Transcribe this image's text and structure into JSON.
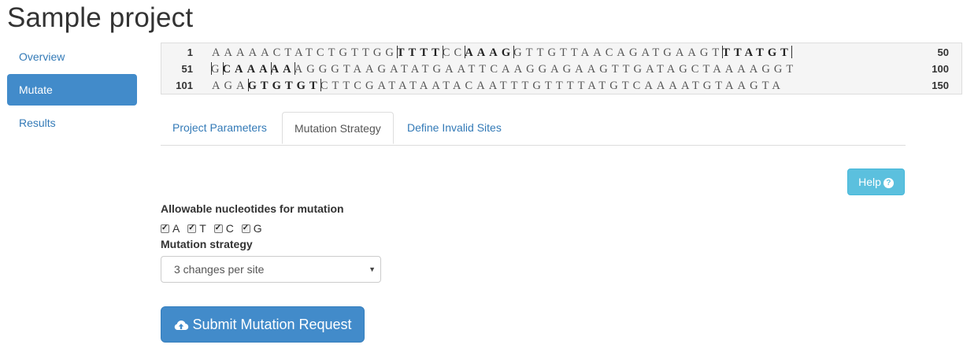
{
  "page": {
    "title": "Sample project"
  },
  "sidebar": {
    "items": [
      {
        "label": "Overview",
        "active": false
      },
      {
        "label": "Mutate",
        "active": true
      },
      {
        "label": "Results",
        "active": false
      }
    ]
  },
  "sequence": {
    "rows": [
      {
        "start": "1",
        "end": "50",
        "parts": [
          {
            "t": "AAAAACTATCTGTTGG",
            "b": false
          },
          {
            "t": "|",
            "bar": true
          },
          {
            "t": "TTTT",
            "b": true
          },
          {
            "t": "|",
            "bar": true
          },
          {
            "t": "CC",
            "b": false
          },
          {
            "t": "|",
            "bar": true
          },
          {
            "t": "AAAG",
            "b": true
          },
          {
            "t": "|",
            "bar": true
          },
          {
            "t": "GTTGTTAACAGATGAAGT",
            "b": false
          },
          {
            "t": "|",
            "bar": true
          },
          {
            "t": "TTATGT",
            "b": true
          },
          {
            "t": "|",
            "bar": true
          }
        ]
      },
      {
        "start": "51",
        "end": "100",
        "parts": [
          {
            "t": "|",
            "bar": true
          },
          {
            "t": "G",
            "b": false
          },
          {
            "t": "|",
            "bar": true
          },
          {
            "t": "CAAA",
            "b": true
          },
          {
            "t": "|",
            "bar": true
          },
          {
            "t": "AA",
            "b": true
          },
          {
            "t": "|",
            "bar": true
          },
          {
            "t": "AGGGTAAGATATGAATTCAAGGAGAAGTTGATAGCTAAAAGGT",
            "b": false
          }
        ]
      },
      {
        "start": "101",
        "end": "150",
        "parts": [
          {
            "t": "AGA",
            "b": false
          },
          {
            "t": "|",
            "bar": true
          },
          {
            "t": "GTGTGT",
            "b": true
          },
          {
            "t": "|",
            "bar": true
          },
          {
            "t": "CTTCGATATAATACAATTTGTTTTATGTCAAAATGTAAGTA",
            "b": false
          }
        ]
      }
    ]
  },
  "tabs": [
    {
      "label": "Project Parameters",
      "active": false
    },
    {
      "label": "Mutation Strategy",
      "active": true
    },
    {
      "label": "Define Invalid Sites",
      "active": false
    }
  ],
  "help": {
    "label": "Help",
    "icon": "question-circle-icon"
  },
  "nucleotides": {
    "label": "Allowable nucleotides for mutation",
    "options": [
      {
        "label": "A",
        "checked": true
      },
      {
        "label": "T",
        "checked": true
      },
      {
        "label": "C",
        "checked": true
      },
      {
        "label": "G",
        "checked": true
      }
    ]
  },
  "strategy": {
    "label": "Mutation strategy",
    "selected": "3 changes per site"
  },
  "submit": {
    "label": "Submit Mutation Request",
    "icon": "cloud-upload-icon"
  },
  "colors": {
    "primary": "#428bca",
    "info": "#5bc0de",
    "link": "#337ab7"
  }
}
